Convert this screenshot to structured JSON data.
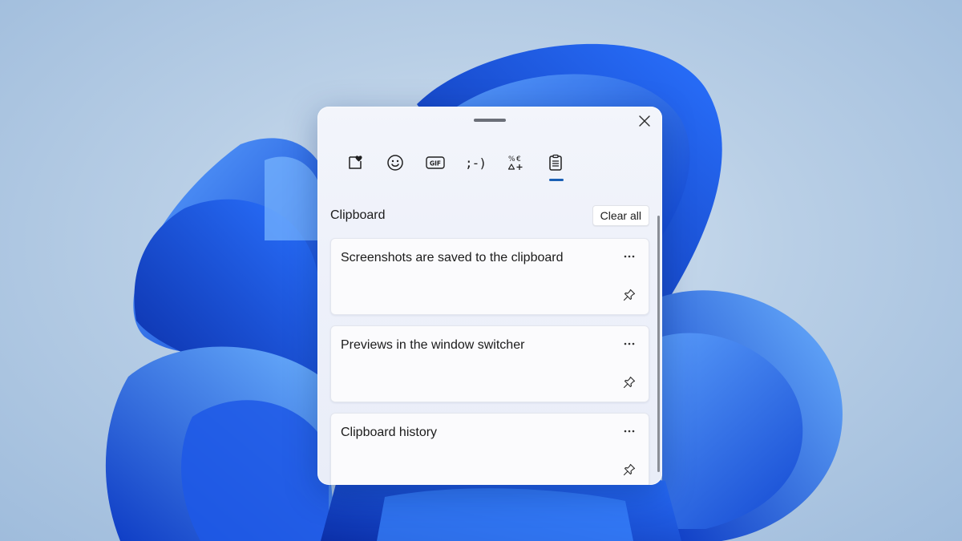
{
  "colors": {
    "accent": "#1a5fb4",
    "wallpaper_blue": "#1f5fe0",
    "panel_bg": "#eef1fa"
  },
  "panel": {
    "close_icon": "close-icon",
    "tabs": [
      {
        "name": "tab-favorites",
        "icon": "heart-note-icon",
        "active": false
      },
      {
        "name": "tab-emoji",
        "icon": "smiley-icon",
        "active": false
      },
      {
        "name": "tab-gif",
        "icon": "gif-icon",
        "label": "GIF",
        "active": false
      },
      {
        "name": "tab-kaomoji",
        "icon": "kaomoji-icon",
        "label": ";-)",
        "active": false
      },
      {
        "name": "tab-symbols",
        "icon": "symbols-icon",
        "active": false
      },
      {
        "name": "tab-clipboard",
        "icon": "clipboard-icon",
        "active": true
      }
    ]
  },
  "clipboard": {
    "title": "Clipboard",
    "clear_all": "Clear all",
    "items": [
      {
        "text": "Screenshots are saved to the clipboard"
      },
      {
        "text": "Previews in the window switcher"
      },
      {
        "text": "Clipboard history"
      }
    ]
  }
}
